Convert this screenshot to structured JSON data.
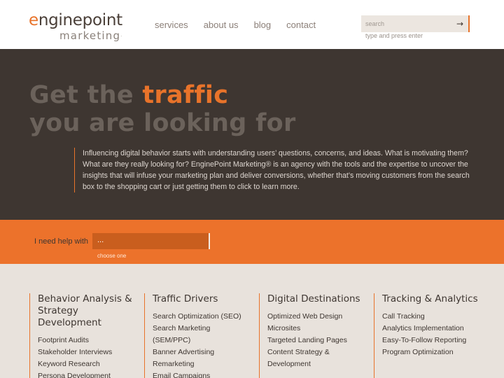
{
  "logo": {
    "main_prefix": "e",
    "main_rest": "nginepoint",
    "sub": "marketing",
    "tm": "."
  },
  "nav": {
    "items": [
      "services",
      "about us",
      "blog",
      "contact"
    ]
  },
  "search": {
    "placeholder": "search",
    "button": "→",
    "hint": "type and press enter"
  },
  "hero": {
    "title_line1_pre": "Get the ",
    "title_line1_accent": "traffic",
    "title_line2": "you are looking for",
    "text": "Influencing digital behavior starts with understanding users’ questions, concerns, and ideas. What is motivating them? What are they really looking for? EnginePoint Marketing® is an agency with the tools and the expertise to uncover the insights that will infuse your marketing plan and deliver conversions, whether that’s moving customers from the search box to the shopping cart or just getting them to click to learn more."
  },
  "help": {
    "label": "I need help with",
    "value": "...",
    "hint": "choose one"
  },
  "services": {
    "columns": [
      {
        "title": "Behavior Analysis & Strategy Development",
        "items": [
          "Footprint Audits",
          "Stakeholder Interviews",
          "Keyword Research",
          "Persona Development"
        ]
      },
      {
        "title": "Traffic Drivers",
        "items": [
          "Search Optimization (SEO)",
          "Search Marketing (SEM/PPC)",
          "Banner Advertising",
          "Remarketing",
          "Email Campaigns"
        ]
      },
      {
        "title": "Digital Destinations",
        "items": [
          "Optimized Web Design",
          "Microsites",
          "Targeted Landing Pages",
          "Content Strategy & Development"
        ]
      },
      {
        "title": "Tracking & Analytics",
        "items": [
          "Call Tracking",
          "Analytics Implementation",
          "Easy-To-Follow Reporting",
          "Program Optimization"
        ]
      }
    ]
  },
  "colors": {
    "accent": "#e8732a",
    "dark": "#3e3631",
    "light": "#e8e2dc"
  }
}
